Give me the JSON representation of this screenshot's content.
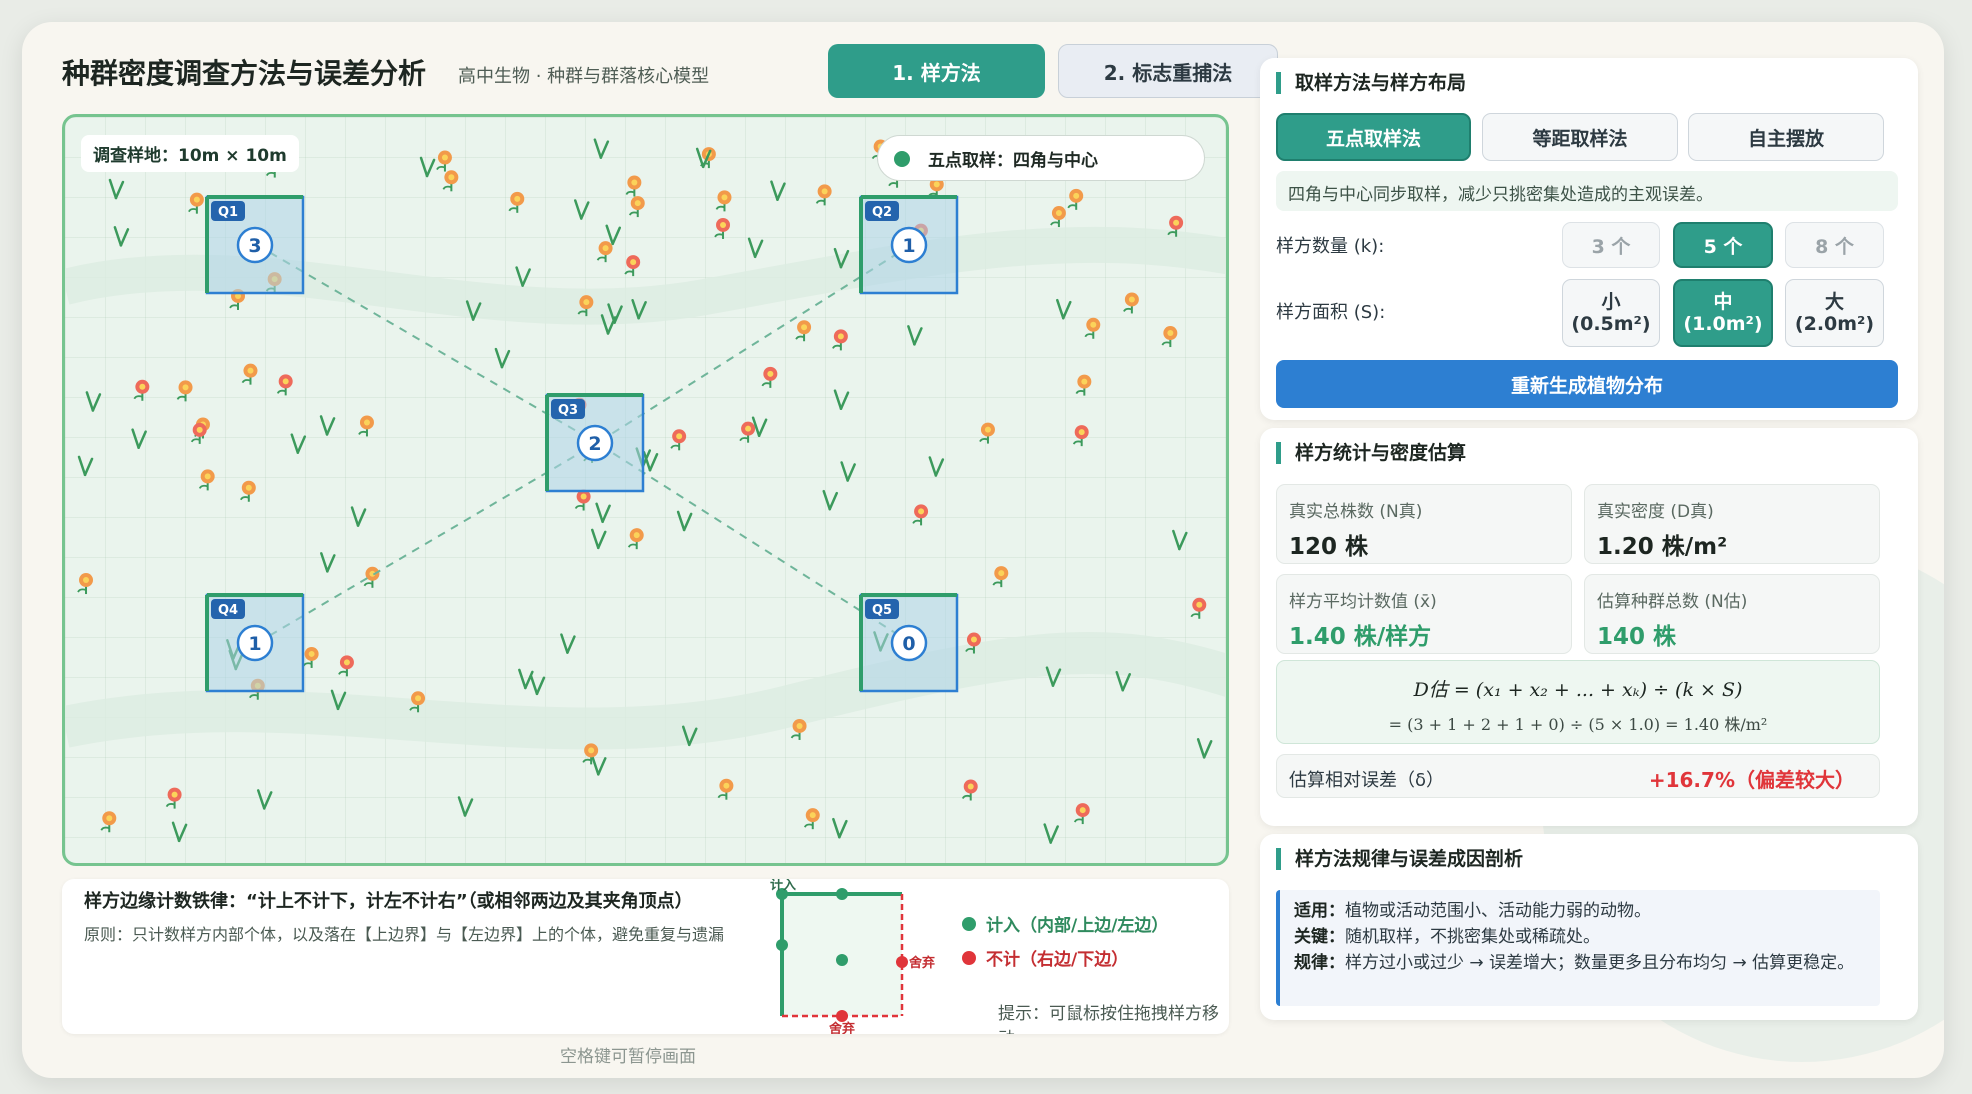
{
  "header": {
    "title": "种群密度调查方法与误差分析",
    "subtitle": "高中生物 · 种群与群落核心模型",
    "tabs": [
      {
        "label": "1. 样方法",
        "active": true
      },
      {
        "label": "2. 标志重捕法",
        "active": false
      }
    ]
  },
  "field": {
    "label": "调查样地：10m × 10m",
    "mode_label": "五点取样：四角与中心",
    "quadrats": [
      {
        "id": "Q1",
        "count": "3"
      },
      {
        "id": "Q2",
        "count": "1"
      },
      {
        "id": "Q3",
        "count": "2"
      },
      {
        "id": "Q4",
        "count": "1"
      },
      {
        "id": "Q5",
        "count": "0"
      }
    ]
  },
  "rule": {
    "title": "样方边缘计数铁律：“计上不计下，计左不计右”（或相邻两边及其夹角顶点）",
    "desc": "原则：只计数样方内部个体，以及落在【上边界】与【左边界】上的个体，避免重复与遗漏",
    "count_in_tag": "计入",
    "discard_right": "舍弃",
    "discard_bottom": "舍弃",
    "legend_in": "计入（内部/上边/左边）",
    "legend_out": "不计（右边/下边）",
    "hint": "提示：可鼠标按住拖拽样方移动"
  },
  "footer_note": "空格键可暂停画面",
  "sampling": {
    "title": "取样方法与样方布局",
    "methods": [
      "五点取样法",
      "等距取样法",
      "自主摆放"
    ],
    "active_method": "五点取样法",
    "method_desc": "四角与中心同步取样，减少只挑密集处造成的主观误差。",
    "k_label": "样方数量 (k):",
    "k_options": [
      "3 个",
      "5 个",
      "8 个"
    ],
    "k_selected": "5 个",
    "s_label": "样方面积 (S):",
    "s_options": [
      {
        "name": "小",
        "size": "(0.5m²)"
      },
      {
        "name": "中",
        "size": "(1.0m²)"
      },
      {
        "name": "大",
        "size": "(2.0m²)"
      }
    ],
    "s_selected": "中",
    "regen_label": "重新生成植物分布"
  },
  "stats": {
    "title": "样方统计与密度估算",
    "true_total_label": "真实总株数 (N真)",
    "true_total_value": "120 株",
    "true_density_label": "真实密度 (D真)",
    "true_density_value": "1.20 株/m²",
    "mean_label": "样方平均计数值 (x̄)",
    "mean_value": "1.40 株/样方",
    "est_total_label": "估算种群总数 (N估)",
    "est_total_value": "140 株",
    "formula_line1": "D估 = (x₁ + x₂ + ... + xₖ) ÷ (k × S)",
    "formula_line2": "= (3 + 1 + 2 + 1 + 0) ÷ (5 × 1.0) = 1.40 株/m²",
    "error_label": "估算相对误差（δ）",
    "error_value": "+16.7%（偏差较大）"
  },
  "analysis": {
    "title": "样方法规律与误差成因剖析",
    "applicable_key": "适用：",
    "applicable": "植物或活动范围小、活动能力弱的动物。",
    "key_key": "关键：",
    "key": "随机取样，不挑密集处或稀疏处。",
    "rule_key": "规律：",
    "rule": "样方过小或过少 → 误差增大；数量更多且分布均匀 → 估算更稳定。"
  },
  "colors": {
    "accent": "#2f9d8a",
    "blue": "#2d7fd2",
    "error": "#e0353a",
    "count_in": "#2f9d6b"
  }
}
